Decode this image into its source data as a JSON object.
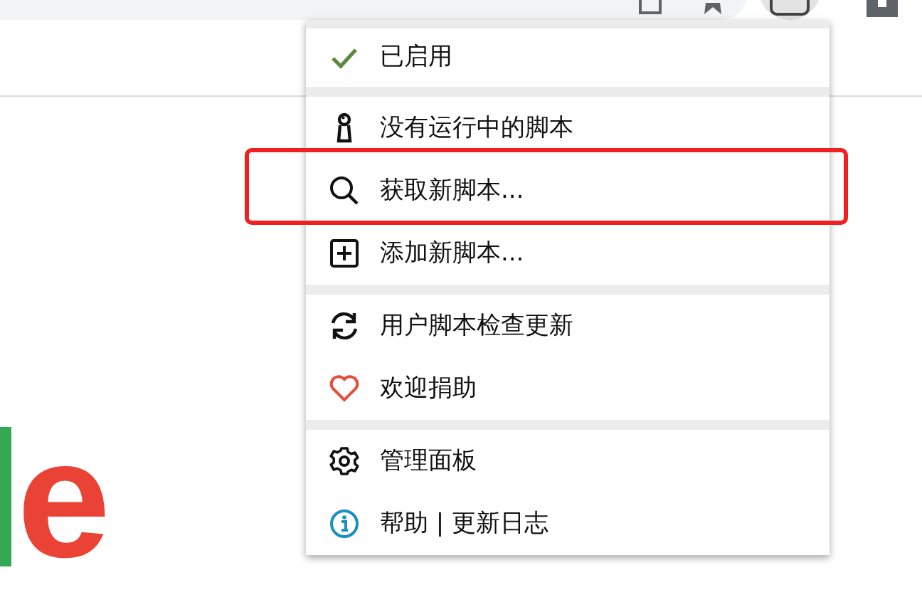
{
  "logo_letters": [
    {
      "text": "e",
      "color": "#ea4335"
    }
  ],
  "menu": {
    "sections": [
      {
        "items": [
          {
            "kind": "toggle",
            "label": "已启用",
            "checked": true,
            "highlighted": false
          }
        ]
      },
      {
        "items": [
          {
            "kind": "info",
            "label": "没有运行中的脚本",
            "highlighted": false
          },
          {
            "kind": "action",
            "label": "获取新脚本...",
            "highlighted": true
          },
          {
            "kind": "action",
            "label": "添加新脚本...",
            "highlighted": false
          }
        ]
      },
      {
        "items": [
          {
            "kind": "action",
            "label": "用户脚本检查更新",
            "highlighted": false
          },
          {
            "kind": "action",
            "label": "欢迎捐助",
            "highlighted": false
          }
        ]
      },
      {
        "items": [
          {
            "kind": "action",
            "label": "管理面板",
            "highlighted": false
          },
          {
            "kind": "action",
            "label": "帮助 | 更新日志",
            "highlighted": false
          }
        ]
      }
    ]
  }
}
